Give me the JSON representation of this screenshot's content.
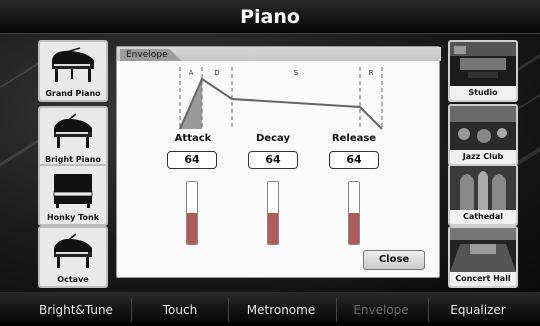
{
  "title": "Piano",
  "left_sounds": [
    {
      "label": "Grand Piano",
      "icon": "grand-piano-icon"
    },
    {
      "label": "Bright Piano",
      "icon": "grand-piano-icon"
    },
    {
      "label": "Honky Tonk",
      "icon": "upright-piano-icon"
    },
    {
      "label": "Octave",
      "icon": "grand-piano-icon"
    }
  ],
  "right_reverbs": [
    {
      "label": "Studio"
    },
    {
      "label": "Jazz Club"
    },
    {
      "label": "Cathedal"
    },
    {
      "label": "Concert Hall"
    }
  ],
  "envelope": {
    "tab_label": "Envelope",
    "phases": [
      "A",
      "D",
      "S",
      "R"
    ],
    "params": [
      {
        "label": "Attack",
        "value": "64",
        "level": 0.5
      },
      {
        "label": "Decay",
        "value": "64",
        "level": 0.5
      },
      {
        "label": "Release",
        "value": "64",
        "level": 0.5
      }
    ],
    "close_label": "Close"
  },
  "menu": [
    {
      "label": "Bright&Tune",
      "enabled": true
    },
    {
      "label": "Touch",
      "enabled": true
    },
    {
      "label": "Metronome",
      "enabled": true
    },
    {
      "label": "Envelope",
      "enabled": false
    },
    {
      "label": "Equalizer",
      "enabled": true
    }
  ],
  "colors": {
    "slider_fill": "#b05a5a",
    "envelope_line": "#666666",
    "attack_fill": "#9a9a9a"
  }
}
